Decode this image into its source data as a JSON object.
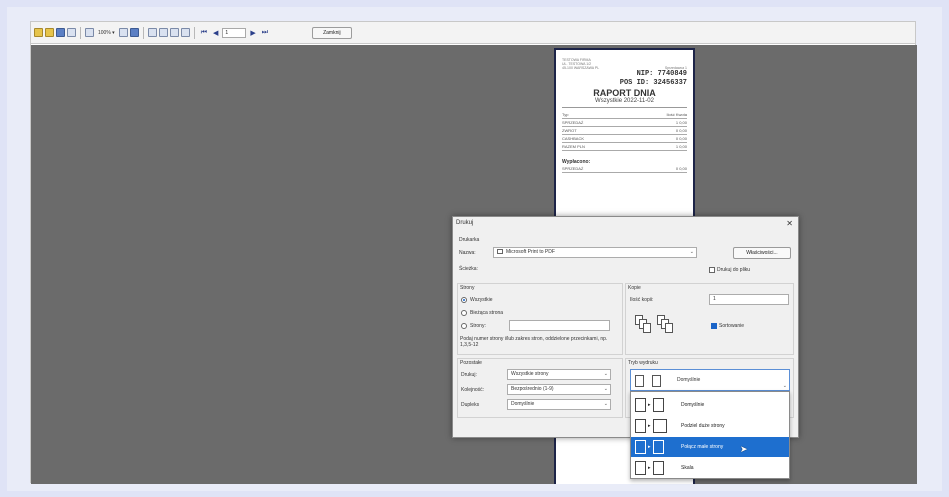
{
  "toolbar": {
    "zoom": "100% ▾",
    "page": "1",
    "close_label": "Zamknij",
    "nav_first": "⏮",
    "nav_prev": "◀",
    "nav_next": "▶",
    "nav_last": "⏭"
  },
  "receipt": {
    "header_lines": [
      "TESTOWA FIRMA",
      "UL. TESTOWA 1/2",
      "45-100 WARSZAWA PL"
    ],
    "seller_tag": "Sprzedawca 1",
    "nip": "NIP: 7740849",
    "pos_id": "POS ID: 32456337",
    "title": "RAPORT DNIA",
    "subtitle": "Wszystkie 2022-11-02",
    "rows": [
      {
        "label": "Typ",
        "a": "Ilość",
        "b": "Kwota"
      },
      {
        "label": "SPRZEDAŻ",
        "a": "1",
        "b": "0,00"
      },
      {
        "label": "ZWROT",
        "a": "0",
        "b": "0,00"
      },
      {
        "label": "CASHBACK",
        "a": "0",
        "b": "0,00"
      },
      {
        "label": "RAZEM PLN",
        "a": "1",
        "b": "0,00"
      }
    ],
    "section2": "Wypłacono:",
    "rows2": [
      {
        "label": "SPRZEDAŻ",
        "a": "0",
        "b": "0,00"
      }
    ]
  },
  "dialog": {
    "title": "Drukuj",
    "close": "✕",
    "printer_group": "Drukarka",
    "name_label": "Nazwa:",
    "printer_name": "Microsoft Print to PDF",
    "properties_button": "Właściwości...",
    "location_label": "Ścieżka:",
    "print_to_file": "Drukuj do pliku",
    "pages_group": "Strony",
    "all_label": "Wszystkie",
    "current_label": "Bieżąca strona",
    "pages_label": "Strony:",
    "pages_hint": "Podaj numer strony i/lub zakres stron, oddzielone przecinkami, np. 1,3,5-12",
    "copies_group": "Kopie",
    "copies_label": "Ilość kopii:",
    "copies_value": "1",
    "collate_label": "Sortowanie",
    "other_group": "Pozostałe",
    "print_label": "Drukuj:",
    "print_value": "Wszystkie strony",
    "order_label": "Kolejność:",
    "order_value": "Bezpośrednio (1-9)",
    "duplex_label": "Dupleks",
    "duplex_value": "Domyślnie",
    "mode_group": "Tryb wydruku",
    "mode_value": "Domyślnie"
  },
  "mode_options": [
    {
      "label": "Domyślnie"
    },
    {
      "label": "Podziel duże strony"
    },
    {
      "label": "Połącz małe strony"
    },
    {
      "label": "Skala"
    }
  ],
  "colors": {
    "selection": "#1e6fcf",
    "viewer_bg": "#6b6b6b"
  }
}
